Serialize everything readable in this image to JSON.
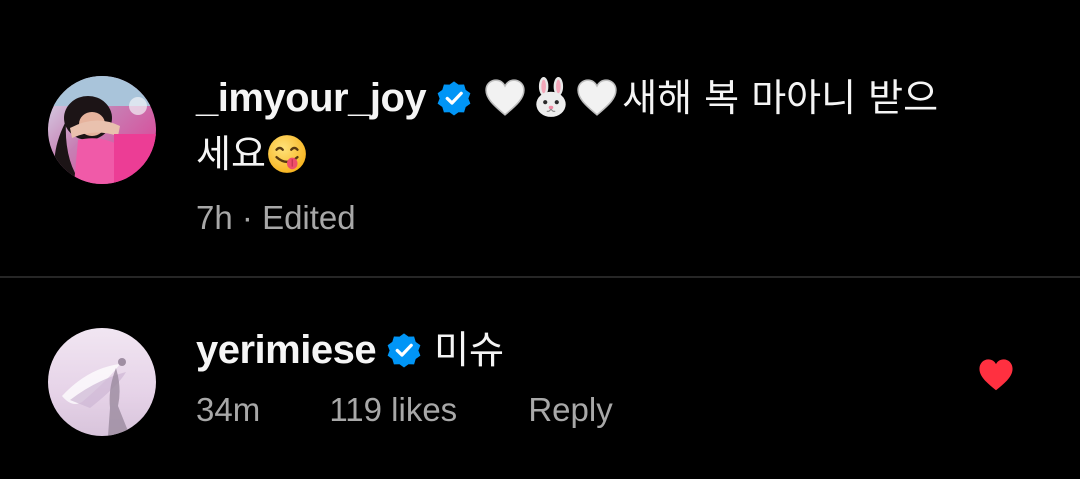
{
  "caption": {
    "username": "_imyour_joy",
    "text_part1": "새해 복 마아니 받으",
    "text_part2": "세요",
    "emojis": [
      "white-heart",
      "rabbit-face",
      "white-heart",
      "face-savoring-food"
    ],
    "time": "7h",
    "separator": "·",
    "edited_label": "Edited"
  },
  "reply": {
    "username": "yerimiese",
    "text": "미슈",
    "time": "34m",
    "likes": "119 likes",
    "reply_label": "Reply",
    "liked": true
  },
  "colors": {
    "background": "#000000",
    "text_primary": "#f5f5f5",
    "text_secondary": "#a8a8a8",
    "verified_badge": "#0095f6",
    "like_heart": "#ff3040",
    "divider": "#262626"
  }
}
